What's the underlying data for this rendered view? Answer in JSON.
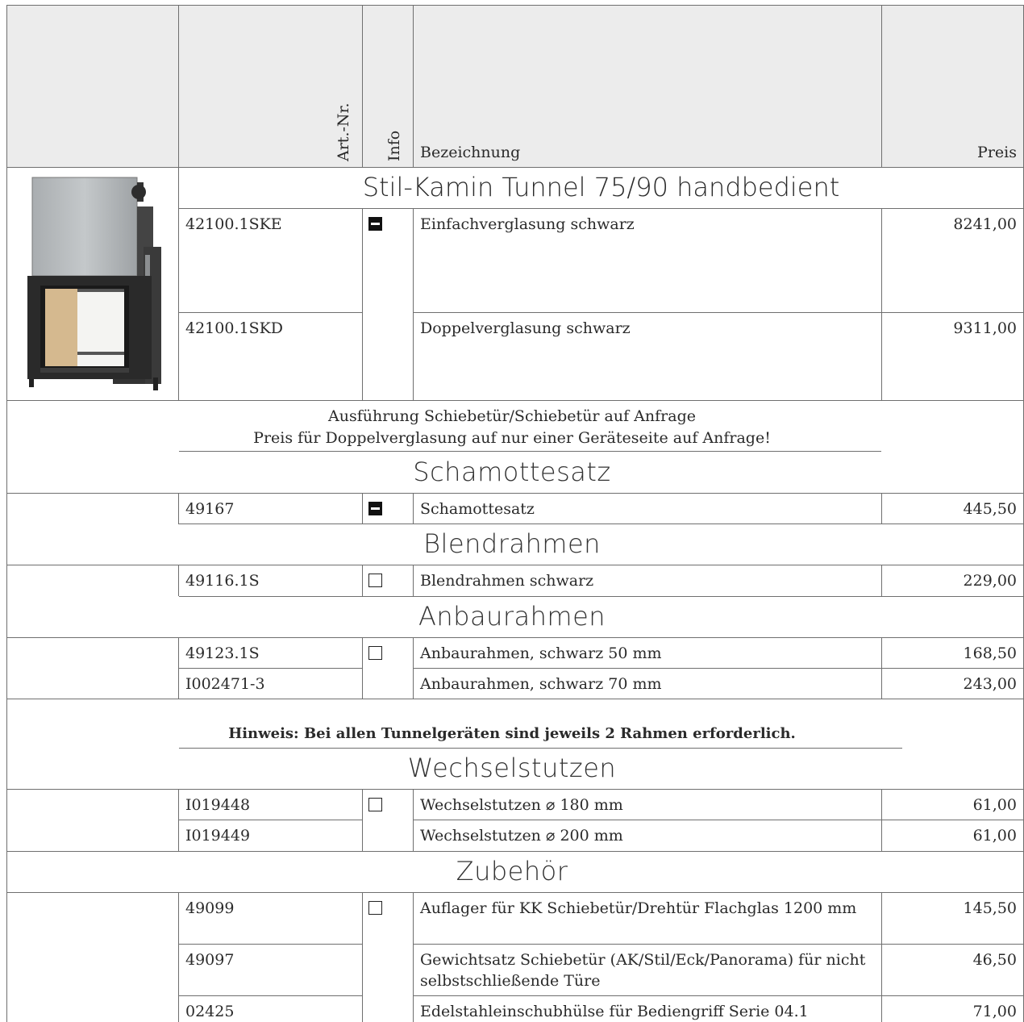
{
  "header": {
    "art_nr": "Art.-Nr.",
    "info": "Info",
    "bezeichnung": "Bezeichnung",
    "preis": "Preis"
  },
  "product": {
    "title": "Stil-Kamin Tunnel 75/90 handbedient",
    "rows": [
      {
        "art": "42100.1SKE",
        "desc": "Einfachverglasung schwarz",
        "price": "8241,00"
      },
      {
        "art": "42100.1SKD",
        "desc": "Doppelverglasung schwarz",
        "price": "9311,00"
      }
    ],
    "notes": [
      "Ausführung Schiebetür/Schiebetür auf Anfrage",
      "Preis für Doppelverglasung auf nur einer Geräteseite auf Anfrage!"
    ]
  },
  "schamotte": {
    "title": "Schamottesatz",
    "rows": [
      {
        "art": "49167",
        "desc": "Schamottesatz",
        "price": "445,50"
      }
    ]
  },
  "blendrahmen": {
    "title": "Blendrahmen",
    "rows": [
      {
        "art": "49116.1S",
        "desc": "Blendrahmen schwarz",
        "price": "229,00"
      }
    ]
  },
  "anbaurahmen": {
    "title": "Anbaurahmen",
    "rows": [
      {
        "art": "49123.1S",
        "desc": "Anbaurahmen, schwarz 50 mm",
        "price": "168,50"
      },
      {
        "art": "I002471-3",
        "desc": "Anbaurahmen, schwarz 70 mm",
        "price": "243,00"
      }
    ],
    "hint": "Hinweis: Bei allen Tunnelgeräten sind jeweils 2 Rahmen erforderlich."
  },
  "wechselstutzen": {
    "title": "Wechselstutzen",
    "rows": [
      {
        "art": "I019448",
        "desc": "Wechselstutzen ⌀ 180 mm",
        "price": "61,00"
      },
      {
        "art": "I019449",
        "desc": "Wechselstutzen ⌀ 200 mm",
        "price": "61,00"
      }
    ]
  },
  "zubehoer": {
    "title": "Zubehör",
    "rows": [
      {
        "art": "49099",
        "desc": "Auflager für KK Schiebetür/Drehtür Flachglas 1200 mm",
        "price": "145,50"
      },
      {
        "art": "49097",
        "desc": "Gewichtsatz Schiebetür (AK/Stil/Eck/Panorama) für nicht selbstschließende Türe",
        "price": "46,50"
      },
      {
        "art": "02425",
        "desc": "Edelstahleinschubhülse für Bediengriff Serie 04.1",
        "price": "71,00"
      }
    ]
  },
  "icons": {
    "filled": "info-filled-box-icon",
    "empty": "info-empty-box-icon"
  }
}
